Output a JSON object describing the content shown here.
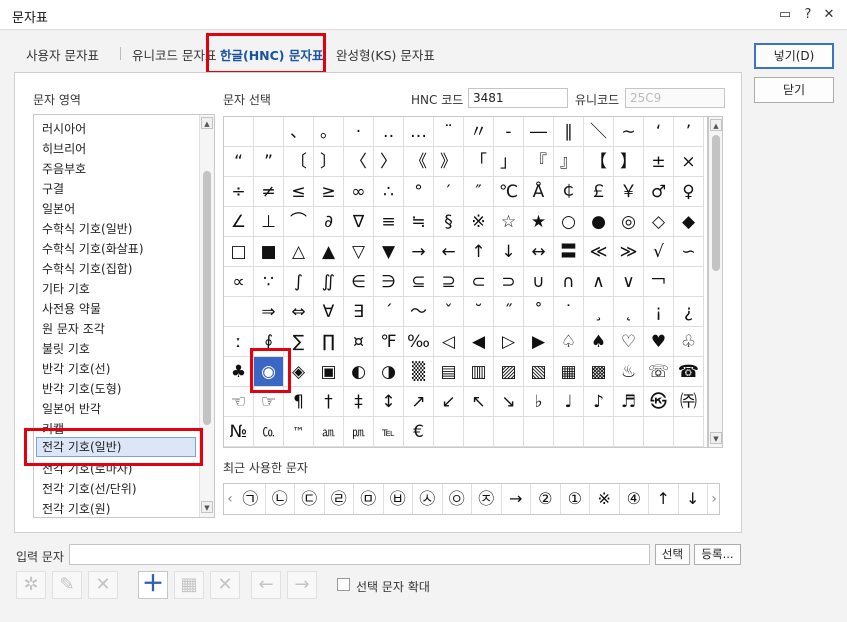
{
  "window": {
    "title": "문자표"
  },
  "tabs": [
    {
      "label": "사용자 문자표"
    },
    {
      "label": "유니코드 문자표"
    },
    {
      "label": "한글(HNC) 문자표"
    },
    {
      "label": "완성형(KS) 문자표"
    }
  ],
  "buttons": {
    "insert": "넣기(D)",
    "close": "닫기",
    "select": "선택",
    "register": "등록..."
  },
  "area": {
    "label": "문자 영역",
    "items": [
      "러시아어",
      "히브리어",
      "주음부호",
      "구결",
      "일본어",
      "수학식 기호(일반)",
      "수학식 기호(화살표)",
      "수학식 기호(집합)",
      "기타 기호",
      "사전용 약물",
      "원 문자 조각",
      "불릿 기호",
      "반각 기호(선)",
      "반각 기호(도형)",
      "일본어 반각",
      "키캡",
      "전각 기호(일반)",
      "전각 기호(로마자)",
      "전각 기호(선/단위)",
      "전각 기호(원)"
    ]
  },
  "selection": {
    "label": "문자 선택",
    "hnc_label": "HNC 코드",
    "hnc_value": "3481",
    "unicode_label": "유니코드",
    "unicode_value": "25C9"
  },
  "grid": {
    "rows": [
      [
        "",
        "",
        "、",
        "。",
        "·",
        "‥",
        "…",
        "¨",
        "〃",
        "-",
        "―",
        "∥",
        "＼",
        "∼",
        "‘",
        "’"
      ],
      [
        "“",
        "”",
        "〔",
        "〕",
        "〈",
        "〉",
        "《",
        "》",
        "「",
        "」",
        "『",
        "』",
        "【",
        "】",
        "±",
        "×"
      ],
      [
        "÷",
        "≠",
        "≤",
        "≥",
        "∞",
        "∴",
        "°",
        "′",
        "″",
        "℃",
        "Å",
        "￠",
        "￡",
        "￥",
        "♂",
        "♀"
      ],
      [
        "∠",
        "⊥",
        "⌒",
        "∂",
        "∇",
        "≡",
        "≒",
        "§",
        "※",
        "☆",
        "★",
        "○",
        "●",
        "◎",
        "◇",
        "◆"
      ],
      [
        "□",
        "■",
        "△",
        "▲",
        "▽",
        "▼",
        "→",
        "←",
        "↑",
        "↓",
        "↔",
        "〓",
        "≪",
        "≫",
        "√",
        "∽"
      ],
      [
        "∝",
        "∵",
        "∫",
        "∬",
        "∈",
        "∋",
        "⊆",
        "⊇",
        "⊂",
        "⊃",
        "∪",
        "∩",
        "∧",
        "∨",
        "￢",
        ""
      ],
      [
        "",
        "⇒",
        "⇔",
        "∀",
        "∃",
        "´",
        "～",
        "ˇ",
        "˘",
        "˝",
        "˚",
        "˙",
        "¸",
        "˛",
        "¡",
        "¿"
      ],
      [
        "ː",
        "∮",
        "∑",
        "∏",
        "¤",
        "℉",
        "‰",
        "◁",
        "◀",
        "▷",
        "▶",
        "♤",
        "♠",
        "♡",
        "♥",
        "♧"
      ],
      [
        "♣",
        "◉",
        "◈",
        "▣",
        "◐",
        "◑",
        "▒",
        "▤",
        "▥",
        "▨",
        "▧",
        "▦",
        "▩",
        "♨",
        "☏",
        "☎"
      ],
      [
        "☜",
        "☞",
        "¶",
        "†",
        "‡",
        "↕",
        "↗",
        "↙",
        "↖",
        "↘",
        "♭",
        "♩",
        "♪",
        "♬",
        "㉿",
        "㈜"
      ],
      [
        "№",
        "㏇",
        "™",
        "㏂",
        "㏘",
        "℡",
        "€",
        "",
        "",
        "",
        "",
        "",
        "",
        "",
        "",
        ""
      ]
    ]
  },
  "recent": {
    "label": "최근 사용한 문자",
    "items": [
      "㉠",
      "㉡",
      "㉢",
      "㉣",
      "㉤",
      "㉥",
      "㉦",
      "㉧",
      "㉨",
      "→",
      "②",
      "①",
      "※",
      "④",
      "↑",
      "↓"
    ]
  },
  "input": {
    "label": "입력 문자",
    "value": ""
  },
  "options": {
    "enlarge_label": "선택 문자 확대"
  },
  "colors": {
    "accent": "#3a66c4",
    "highlight_box": "#e3000f"
  }
}
